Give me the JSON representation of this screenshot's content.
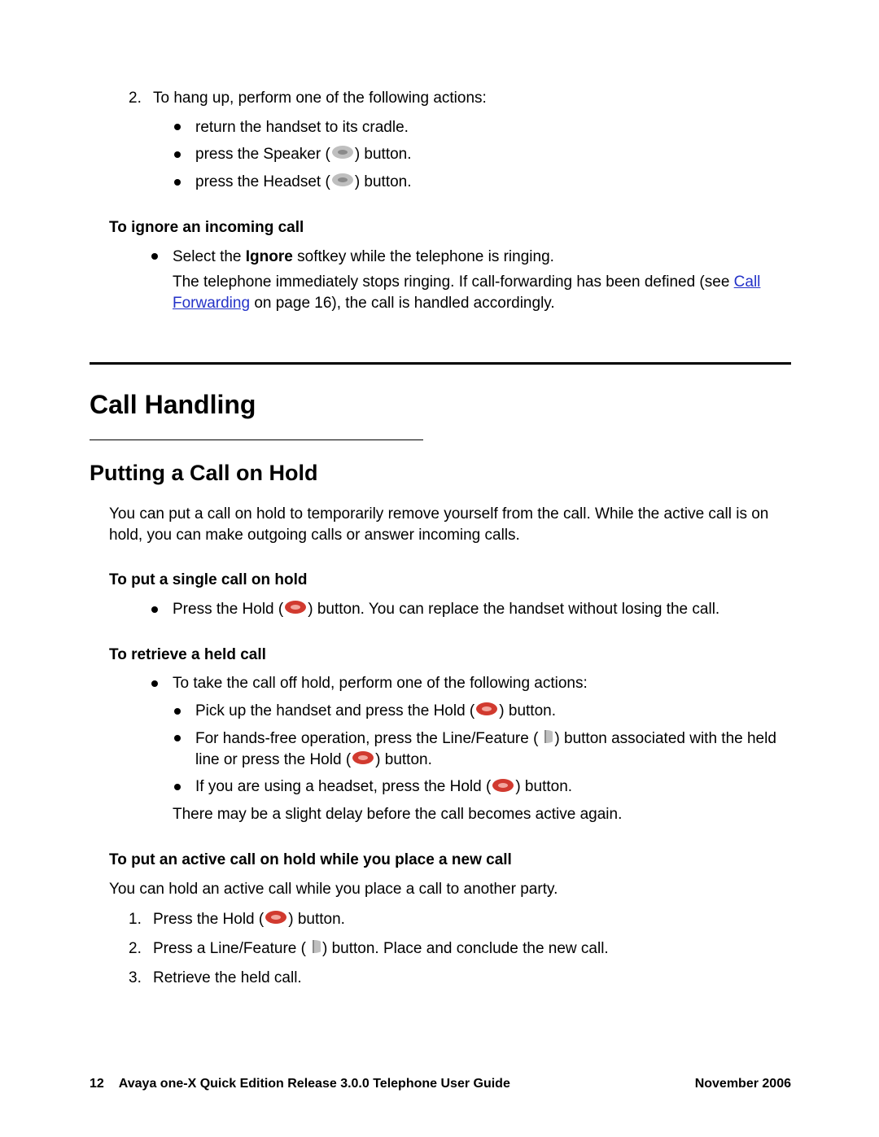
{
  "step2": {
    "marker": "2.",
    "text": "To hang up, perform one of the following actions:",
    "bullets": [
      "return the handset to its cradle.",
      "press the Speaker (",
      "press the Headset ("
    ],
    "bullets_tail": ") button."
  },
  "ignore": {
    "heading": "To ignore an incoming call",
    "b1_pre": "Select the ",
    "b1_bold": "Ignore",
    "b1_post": " softkey while the telephone is ringing.",
    "follow_pre": "The telephone immediately stops ringing. If call-forwarding has been defined (see ",
    "link": "Call Forwarding",
    "follow_post": " on page 16), the call is handled accordingly."
  },
  "h1": "Call Handling",
  "h2": "Putting a Call on Hold",
  "hold_intro": "You can put a call on hold to temporarily remove yourself from the call. While the active call is on hold, you can make outgoing calls or answer incoming calls.",
  "single": {
    "heading": "To put a single call on hold",
    "b_pre": "Press the Hold (",
    "b_post": ") button. You can replace the handset without losing the call."
  },
  "retrieve": {
    "heading": "To retrieve a held call",
    "lead": "To take the call off hold, perform one of the following actions:",
    "s1_pre": "Pick up the handset and press the Hold (",
    "s1_post": ") button.",
    "s2_pre": "For hands-free operation, press the Line/Feature (",
    "s2_mid": ") button associated with the held line or press the Hold (",
    "s2_post": ") button.",
    "s3_pre": "If you are using a headset, press the Hold (",
    "s3_post": ") button.",
    "tail": "There may be a slight delay before the call becomes active again."
  },
  "newcall": {
    "heading": "To put an active call on hold while you place a new call",
    "intro": "You can hold an active call while you place a call to another party.",
    "n1_marker": "1.",
    "n1_pre": "Press the Hold (",
    "n1_post": ") button.",
    "n2_marker": "2.",
    "n2_pre": "Press a Line/Feature (",
    "n2_post": ") button. Place and conclude the new call.",
    "n3_marker": "3.",
    "n3_text": "Retrieve the held call."
  },
  "footer": {
    "page": "12",
    "title": "Avaya one-X Quick Edition Release 3.0.0 Telephone User Guide",
    "date": "November 2006"
  }
}
